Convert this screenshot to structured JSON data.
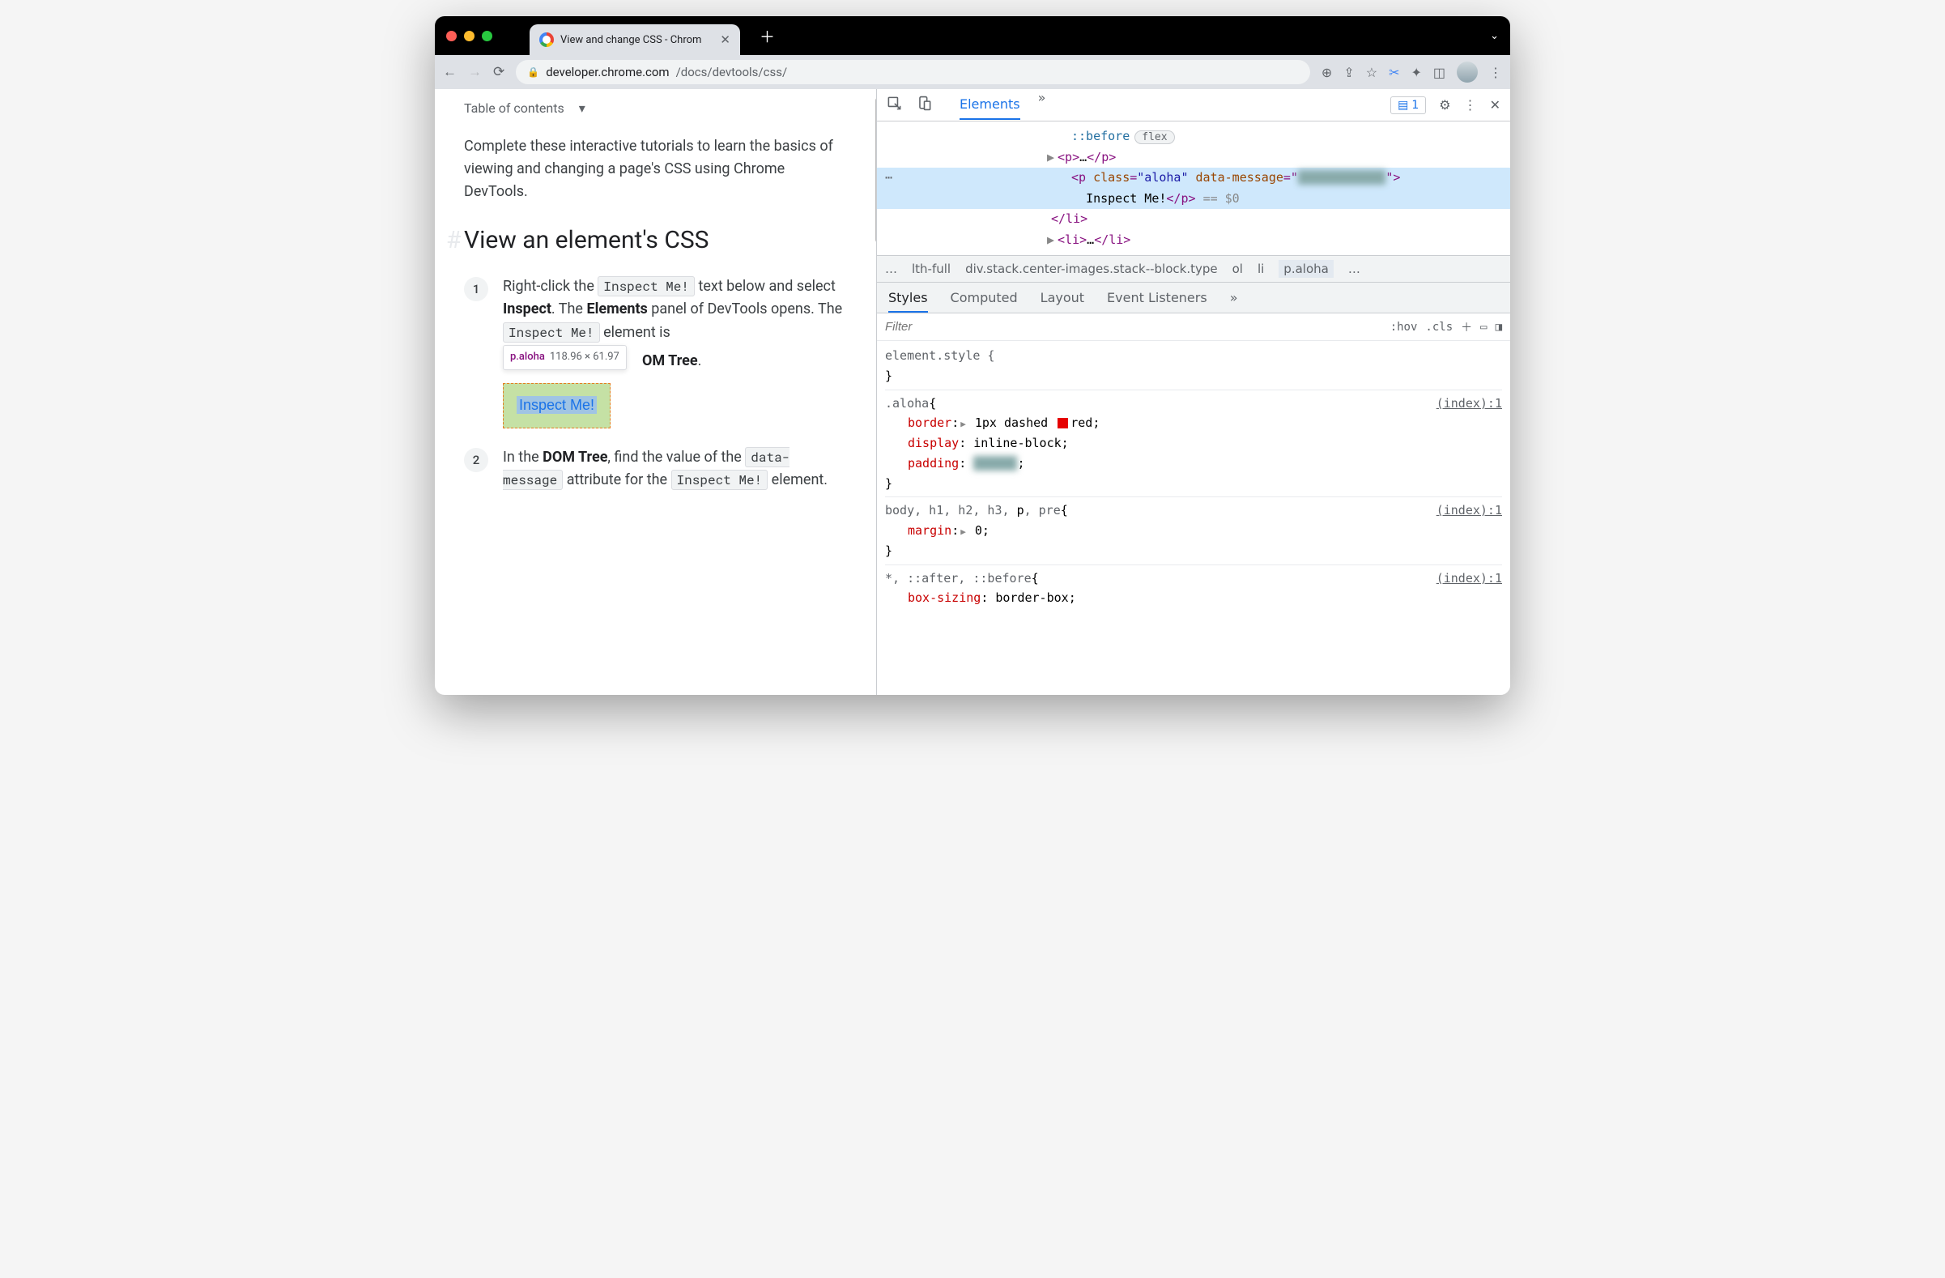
{
  "browser": {
    "tab_title": "View and change CSS - Chrom",
    "url_domain": "developer.chrome.com",
    "url_path": "/docs/devtools/css/"
  },
  "page": {
    "toc": "Table of contents",
    "intro": "Complete these interactive tutorials to learn the basics of viewing and changing a page's CSS using Chrome DevTools.",
    "h2": "View an element's CSS",
    "step1_a": "Right-click the ",
    "step1_code1": "Inspect Me!",
    "step1_b": " text below and select ",
    "step1_inspect": "Inspect",
    "step1_c": ". The ",
    "step1_elements": "Elements",
    "step1_d": " panel of DevTools opens. The ",
    "step1_code2": "Inspect Me!",
    "step1_e": " element is",
    "step1_suffix": "OM Tree",
    "tooltip_tag": "p.aloha",
    "tooltip_dim": "118.96 × 61.97",
    "inspect_box": "Inspect Me!",
    "step2_a": "In the ",
    "step2_dom": "DOM Tree",
    "step2_b": ", find the value of the ",
    "step2_code1": "data-message",
    "step2_c": " attribute for the ",
    "step2_code2": "Inspect Me!",
    "step2_d": " element."
  },
  "devtools": {
    "tab_elements": "Elements",
    "issues": "1",
    "dom": {
      "pseudo": "::before",
      "flex_badge": "flex",
      "p_open": "<p>",
      "p_close": "</p>",
      "sel_open": "<p ",
      "sel_class_n": "class",
      "sel_class_v": "\"aloha\"",
      "sel_data_n": "data-message",
      "sel_text": "Inspect Me!",
      "sel_end": "</p>",
      "dollar": "== $0",
      "li_close": "</li>",
      "li2_open": "<li>",
      "li2_close": "</li>"
    },
    "crumbs": {
      "truncated": "lth-full",
      "div": "div.stack.center-images.stack--block.type",
      "ol": "ol",
      "li": "li",
      "active": "p.aloha"
    },
    "sub_tabs": {
      "styles": "Styles",
      "computed": "Computed",
      "layout": "Layout",
      "events": "Event Listeners"
    },
    "filter_placeholder": "Filter",
    "hov": ":hov",
    "cls": ".cls",
    "rules": {
      "el_style": "element.style",
      "aloha_sel": ".aloha",
      "border_n": "border",
      "border_v1": "1px dashed",
      "border_v2": "red",
      "display_n": "display",
      "display_v": "inline-block",
      "padding_n": "padding",
      "src1": "(index):1",
      "body_sel": "body, h1, h2, h3, ",
      "body_p": "p",
      "body_pre": ", pre",
      "margin_n": "margin",
      "margin_v": "0",
      "star_sel": "*, ::after, ::before",
      "bs_n": "box-sizing",
      "bs_v": "border-box"
    }
  }
}
